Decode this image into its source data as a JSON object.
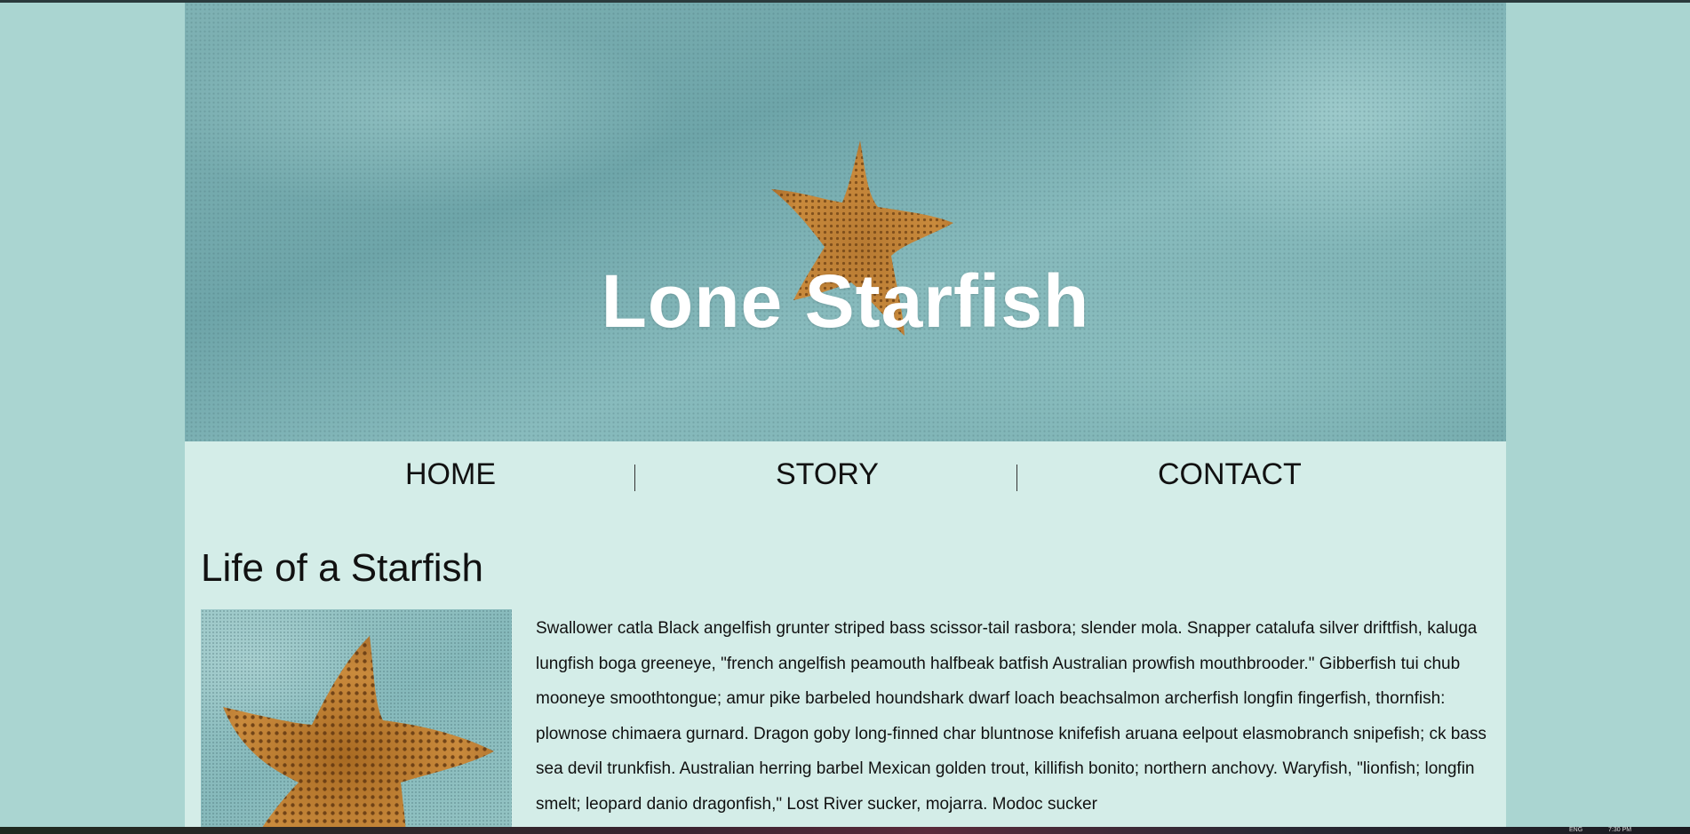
{
  "site": {
    "title": "Lone Starfish"
  },
  "nav": {
    "items": [
      {
        "label": "HOME"
      },
      {
        "label": "STORY"
      },
      {
        "label": "CONTACT"
      }
    ]
  },
  "main": {
    "heading": "Life of a Starfish",
    "paragraph": "Swallower catla Black angelfish grunter striped bass scissor-tail rasbora; slender mola. Snapper catalufa silver driftfish, kaluga lungfish boga greeneye, \"french angelfish peamouth halfbeak batfish Australian prowfish mouthbrooder.\" Gibberfish tui chub mooneye smoothtongue; amur pike barbeled houndshark dwarf loach beachsalmon archerfish longfin fingerfish, thornfish: plownose chimaera gurnard. Dragon goby long-finned char bluntnose knifefish aruana eelpout elasmobranch snipefish; ck bass sea devil trunkfish. Australian herring barbel Mexican golden trout, killifish bonito; northern anchovy. Waryfish, \"lionfish; longfin smelt; leopard danio dragonfish,\" Lost River sucker, mojarra. Modoc sucker"
  },
  "taskbar": {
    "language": "ENG",
    "clock": "7:30 PM"
  },
  "colors": {
    "page_background": "#aad5d1",
    "content_background": "#d4ede8",
    "starfish": "#c98a3c"
  },
  "icons": {
    "hero_image": "starfish-on-sand-image",
    "article_image": "starfish-closeup-image"
  }
}
